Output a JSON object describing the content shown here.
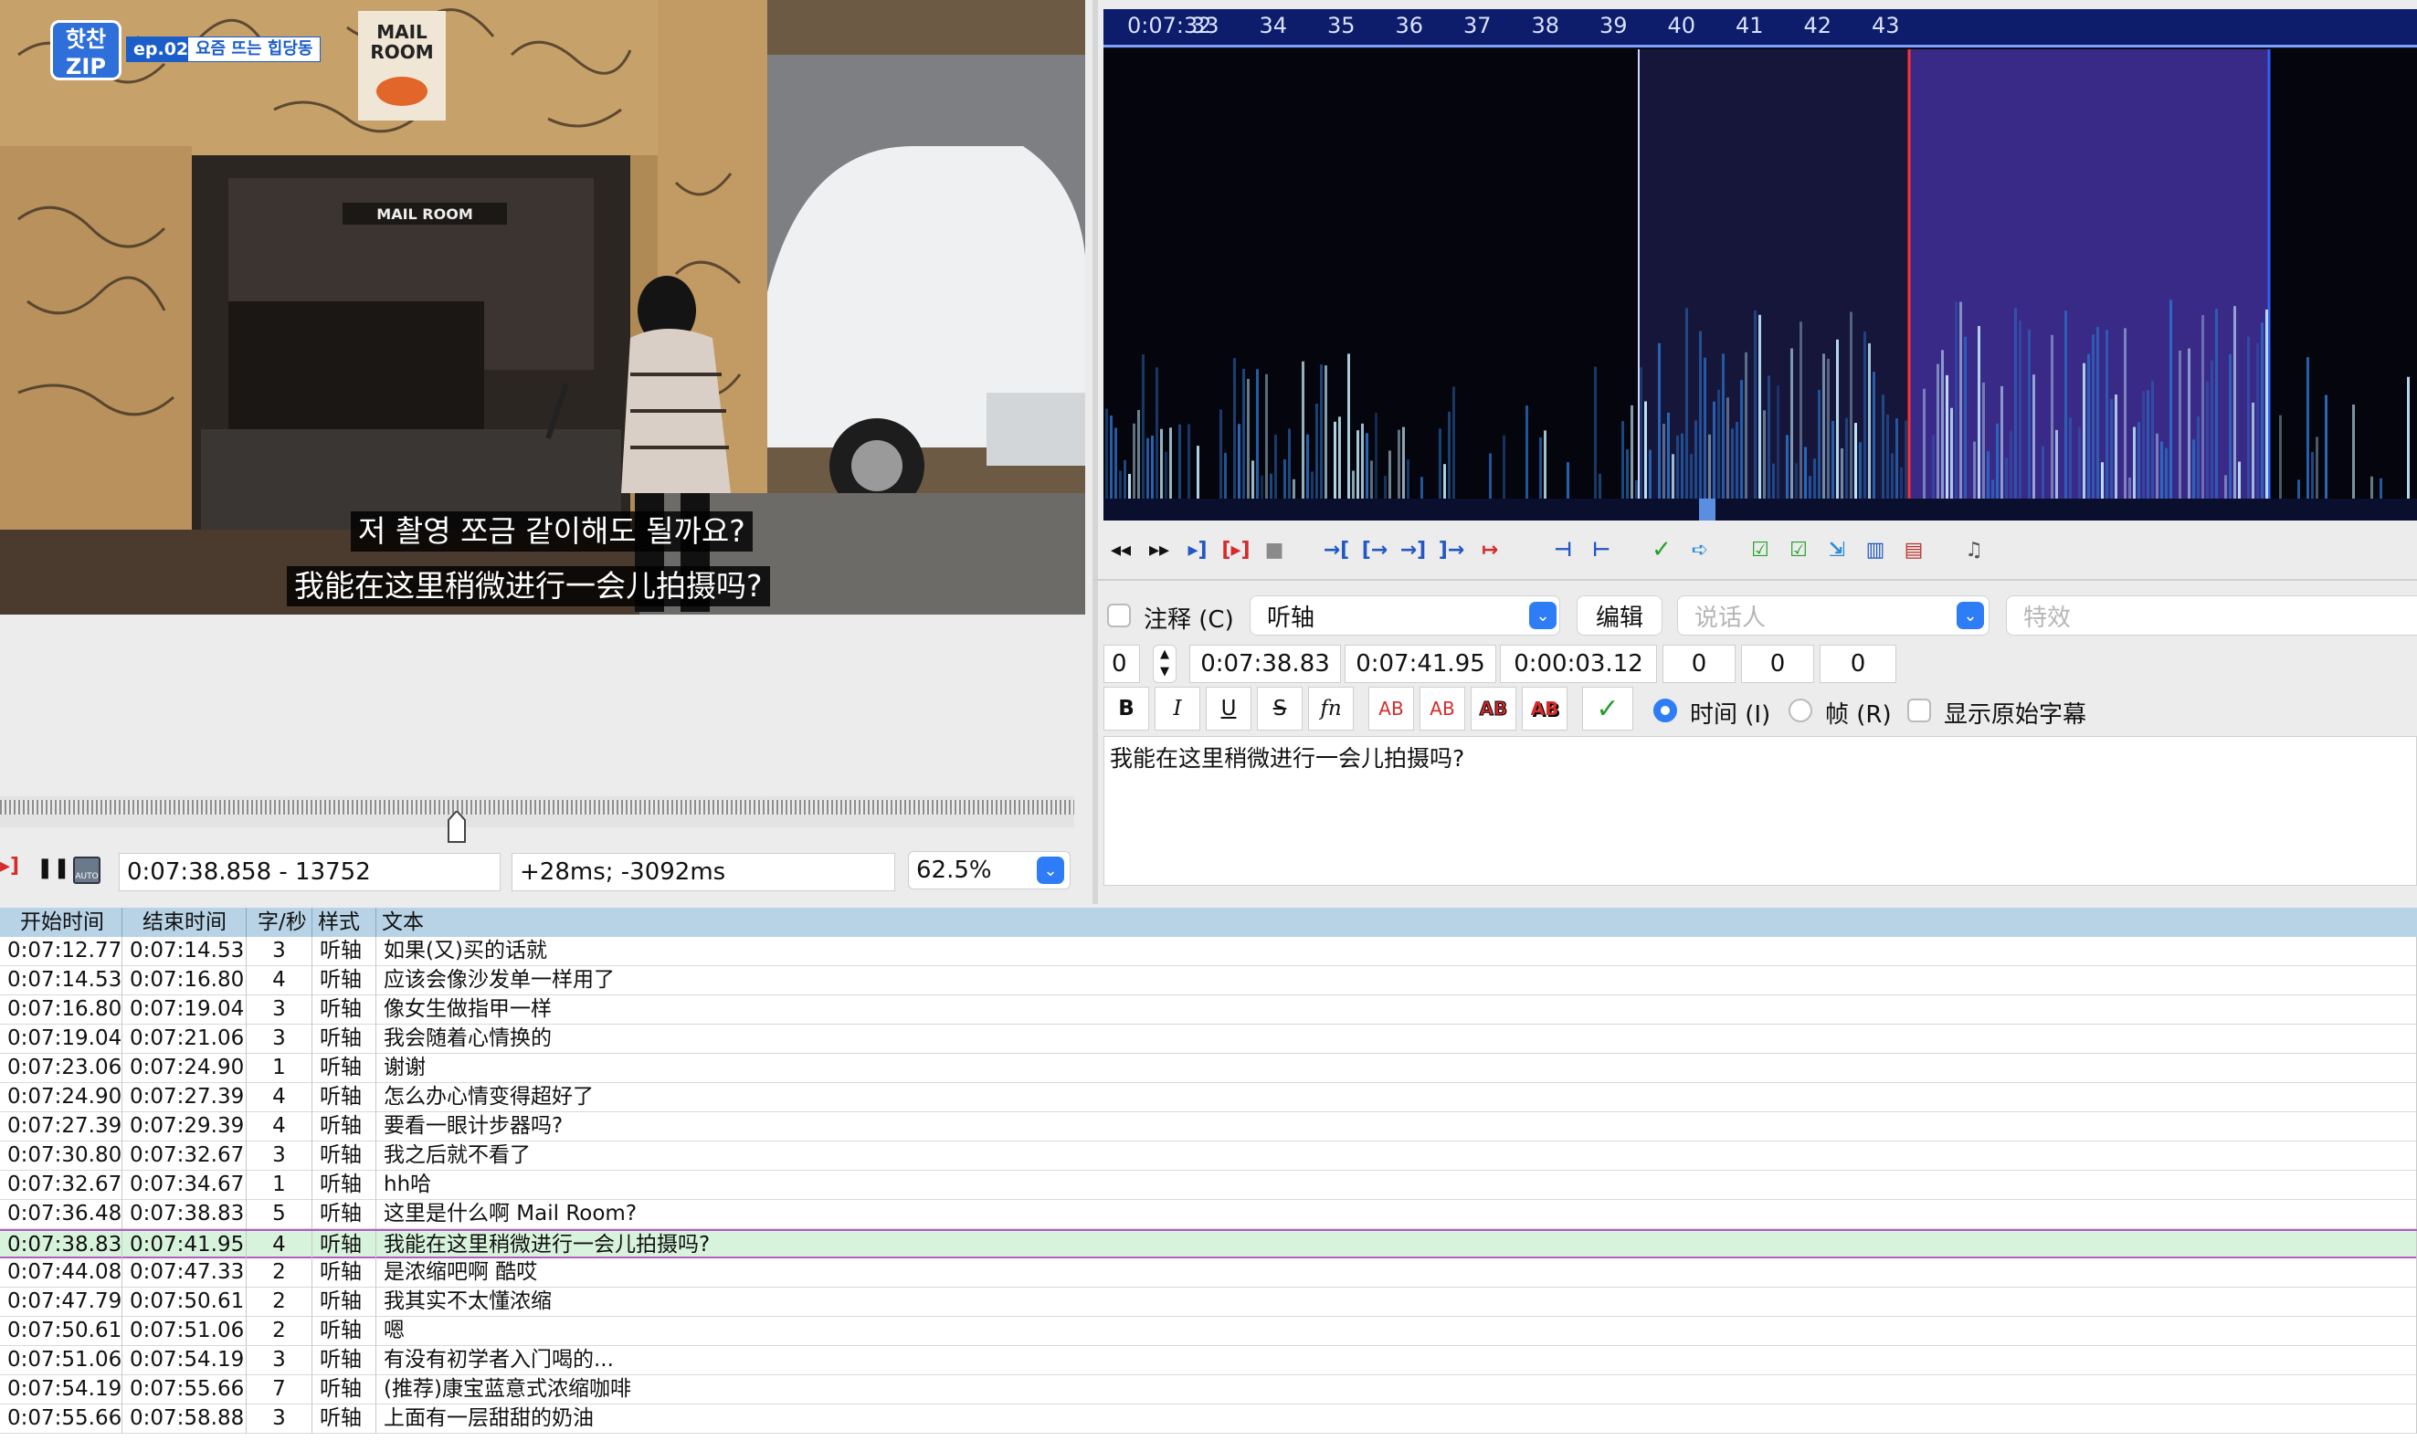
{
  "video": {
    "logo_text": "핫찬 ZIP",
    "episode_badge": "ep.02",
    "episode_title": "요즘 뜨는 힙당동",
    "sign_text": "MAIL ROOM",
    "subtitle_korean": "저 촬영 쪼금 같이해도 될까요?",
    "subtitle_chinese": "我能在这里稍微进行一会儿拍摄吗?"
  },
  "player": {
    "position_readout": "0:07:38.858 - 13752",
    "offset_readout": "+28ms; -3092ms",
    "zoom": "62.5%",
    "progress_fraction": 0.425
  },
  "waveform": {
    "start_label": "0:07:32",
    "tick_labels": [
      "33",
      "34",
      "35",
      "36",
      "37",
      "38",
      "39",
      "40",
      "41",
      "42",
      "43"
    ],
    "selection_color": "#3a2a88",
    "ruler_color": "#0d1c6b"
  },
  "editor": {
    "comment_label": "注释 (C)",
    "style_value": "听轴",
    "edit_button": "编辑",
    "speaker_placeholder": "说话人",
    "effect_placeholder": "特效",
    "layer": "0",
    "start_time": "0:07:38.83",
    "end_time": "0:07:41.95",
    "duration": "0:00:03.12",
    "margin_l": "0",
    "margin_r": "0",
    "margin_v": "0",
    "bold": "B",
    "italic": "I",
    "underline": "U",
    "strike": "S",
    "font_fn": "fn",
    "color_btns": [
      "AB",
      "AB",
      "AB",
      "AB"
    ],
    "time_radio": "时间 (I)",
    "frame_radio": "帧 (R)",
    "show_original": "显示原始字幕",
    "text": "我能在这里稍微进行一会儿拍摄吗?"
  },
  "table": {
    "headers": [
      "开始时间",
      "结束时间",
      "字/秒",
      "样式",
      "文本"
    ],
    "rows": [
      {
        "start": "0:07:12.77",
        "end": "0:07:14.53",
        "cps": "3",
        "style": "听轴",
        "text": "如果(又)买的话就"
      },
      {
        "start": "0:07:14.53",
        "end": "0:07:16.80",
        "cps": "4",
        "style": "听轴",
        "text": "应该会像沙发单一样用了"
      },
      {
        "start": "0:07:16.80",
        "end": "0:07:19.04",
        "cps": "3",
        "style": "听轴",
        "text": "像女生做指甲一样"
      },
      {
        "start": "0:07:19.04",
        "end": "0:07:21.06",
        "cps": "3",
        "style": "听轴",
        "text": "我会随着心情换的"
      },
      {
        "start": "0:07:23.06",
        "end": "0:07:24.90",
        "cps": "1",
        "style": "听轴",
        "text": "谢谢"
      },
      {
        "start": "0:07:24.90",
        "end": "0:07:27.39",
        "cps": "4",
        "style": "听轴",
        "text": "怎么办心情变得超好了"
      },
      {
        "start": "0:07:27.39",
        "end": "0:07:29.39",
        "cps": "4",
        "style": "听轴",
        "text": "要看一眼计步器吗?"
      },
      {
        "start": "0:07:30.80",
        "end": "0:07:32.67",
        "cps": "3",
        "style": "听轴",
        "text": "我之后就不看了"
      },
      {
        "start": "0:07:32.67",
        "end": "0:07:34.67",
        "cps": "1",
        "style": "听轴",
        "text": "hh哈"
      },
      {
        "start": "0:07:36.48",
        "end": "0:07:38.83",
        "cps": "5",
        "style": "听轴",
        "text": "这里是什么啊 Mail Room?"
      },
      {
        "start": "0:07:38.83",
        "end": "0:07:41.95",
        "cps": "4",
        "style": "听轴",
        "text": "我能在这里稍微进行一会儿拍摄吗?",
        "selected": true
      },
      {
        "start": "0:07:44.08",
        "end": "0:07:47.33",
        "cps": "2",
        "style": "听轴",
        "text": "是浓缩吧啊 酷哎"
      },
      {
        "start": "0:07:47.79",
        "end": "0:07:50.61",
        "cps": "2",
        "style": "听轴",
        "text": "我其实不太懂浓缩"
      },
      {
        "start": "0:07:50.61",
        "end": "0:07:51.06",
        "cps": "2",
        "style": "听轴",
        "text": "嗯"
      },
      {
        "start": "0:07:51.06",
        "end": "0:07:54.19",
        "cps": "3",
        "style": "听轴",
        "text": "有没有初学者入门喝的..."
      },
      {
        "start": "0:07:54.19",
        "end": "0:07:55.66",
        "cps": "7",
        "style": "听轴",
        "text": "(推荐)康宝蓝意式浓缩咖啡"
      },
      {
        "start": "0:07:55.66",
        "end": "0:07:58.88",
        "cps": "3",
        "style": "听轴",
        "text": "上面有一层甜甜的奶油"
      }
    ]
  }
}
